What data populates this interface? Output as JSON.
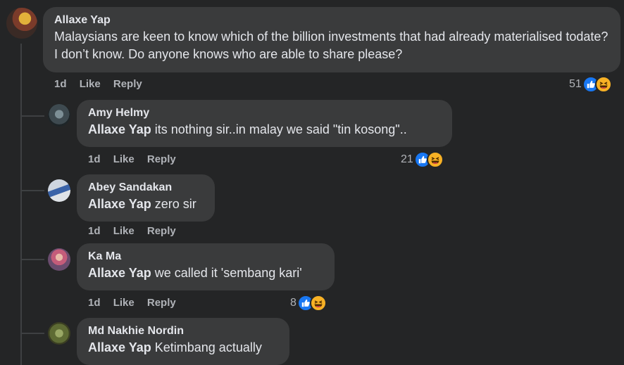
{
  "comment": {
    "author": "Allaxe Yap",
    "text": "Malaysians are keen to know which of the billion investments that had already materialised todate? I don’t know. Do anyone knows who are able to share please?",
    "time": "1d",
    "like_label": "Like",
    "reply_label": "Reply",
    "reaction_count": "51",
    "reaction_icons": [
      "like-icon",
      "haha-icon"
    ]
  },
  "replies": [
    {
      "author": "Amy Helmy",
      "mention": "Allaxe Yap",
      "text": "its nothing sir..in malay we said \"tin kosong\"..",
      "time": "1d",
      "like_label": "Like",
      "reply_label": "Reply",
      "reaction_count": "21",
      "reaction_icons": [
        "like-icon",
        "haha-icon"
      ]
    },
    {
      "author": "Abey Sandakan",
      "mention": "Allaxe Yap",
      "text": "zero sir",
      "time": "1d",
      "like_label": "Like",
      "reply_label": "Reply"
    },
    {
      "author": "Ka Ma",
      "mention": "Allaxe Yap",
      "text": "we called it 'sembang kari'",
      "time": "1d",
      "like_label": "Like",
      "reply_label": "Reply",
      "reaction_count": "8",
      "reaction_icons": [
        "like-icon",
        "haha-icon"
      ]
    },
    {
      "author": "Md Nakhie Nordin",
      "mention": "Allaxe Yap",
      "text": "Ketimbang actually"
    }
  ],
  "colors": {
    "background": "#242526",
    "bubble": "#3a3b3c",
    "text": "#e4e6eb",
    "secondary_text": "#b0b3b8",
    "like_blue": "#1877f2",
    "haha_yellow": "#f7b125"
  }
}
